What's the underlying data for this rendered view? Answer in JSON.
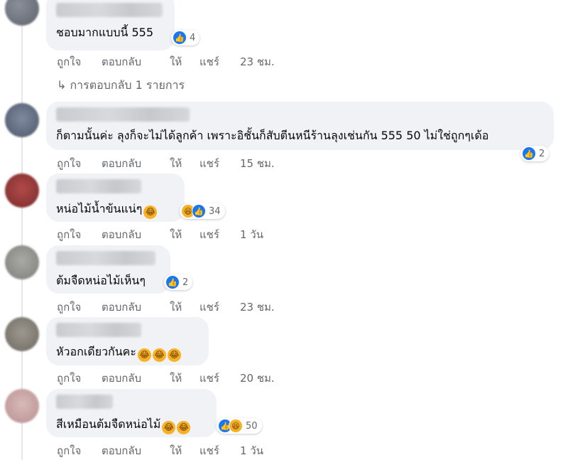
{
  "colors": {
    "bubble": "#f0f2f5",
    "like_blue": "#1877f2",
    "haha_yellow": "#f7b125",
    "meta_gray": "#65676b"
  },
  "actions": {
    "like": "ถูกใจ",
    "reply": "ตอบกลับ",
    "give": "ให้",
    "share": "แชร์"
  },
  "comments": [
    {
      "text": "ชอบมากแบบนี้ 555",
      "reactions": [
        "like-icon"
      ],
      "reaction_count": "4",
      "time": "23 ชม."
    },
    {
      "text": "ก็ตามนั้นค่ะ ลุงก็จะไม่ได้ลูกค้า เพราะอิชั้นก็สับตีนหนีร้านลุงเช่นกัน 555 50 ไม่ใช่ถูกๆเด้อ",
      "reactions": [
        "like-icon"
      ],
      "reaction_count": "2",
      "time": "15 ชม."
    },
    {
      "text": "หน่อไม้น้ำข้นแน่ๆ",
      "emoji": "laughing-emoji",
      "reactions": [
        "haha-icon",
        "like-icon"
      ],
      "reaction_count": "34",
      "time": "1 วัน"
    },
    {
      "text": "ต้มจืดหน่อไม้เห็นๆ",
      "reactions": [
        "like-icon"
      ],
      "reaction_count": "2",
      "time": "23 ชม."
    },
    {
      "text": "หัวอกเดียวกันคะ",
      "emoji": "laughing-emoji",
      "reactions": [],
      "reaction_count": "",
      "time": "20 ชม."
    },
    {
      "text": "สีเหมือนต้มจืดหน่อไม้",
      "emoji": "laughing-emoji",
      "reactions": [
        "like-icon",
        "haha-icon"
      ],
      "reaction_count": "50",
      "time": "1 วัน"
    }
  ],
  "view_replies": "↳ การตอบกลับ 1 รายการ"
}
